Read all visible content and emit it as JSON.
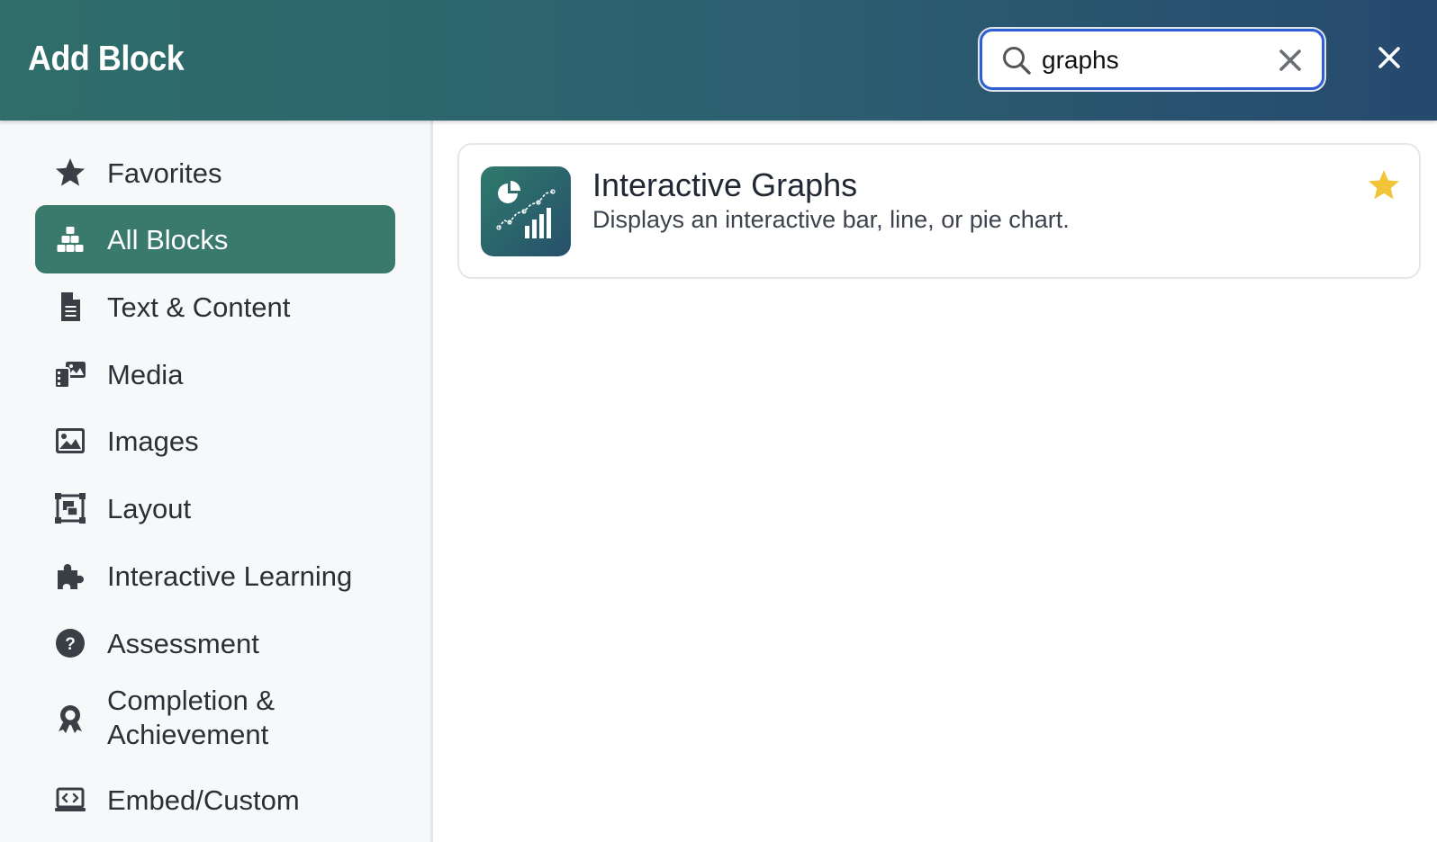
{
  "header": {
    "title": "Add Block",
    "search": {
      "value": "graphs",
      "placeholder": ""
    }
  },
  "colors": {
    "header_gradient": [
      "#2f6e6a",
      "#26496e"
    ],
    "active_nav": "#3a7a6c",
    "search_border": "#2d5fd2",
    "favorite_star": "#f2c438"
  },
  "sidebar": {
    "items": [
      {
        "label": "Favorites",
        "icon": "star-icon",
        "active": false
      },
      {
        "label": "All Blocks",
        "icon": "blocks-icon",
        "active": true
      },
      {
        "label": "Text & Content",
        "icon": "document-icon",
        "active": false
      },
      {
        "label": "Media",
        "icon": "media-icon",
        "active": false
      },
      {
        "label": "Images",
        "icon": "image-icon",
        "active": false
      },
      {
        "label": "Layout",
        "icon": "layout-icon",
        "active": false
      },
      {
        "label": "Interactive Learning",
        "icon": "puzzle-icon",
        "active": false
      },
      {
        "label": "Assessment",
        "icon": "question-circle-icon",
        "active": false
      },
      {
        "label": "Completion & Achievement",
        "icon": "award-icon",
        "active": false
      },
      {
        "label": "Embed/Custom",
        "icon": "embed-icon",
        "active": false
      }
    ]
  },
  "results": [
    {
      "title": "Interactive Graphs",
      "description": "Displays an interactive bar, line, or pie chart.",
      "icon": "chart-icon",
      "favorite": true
    }
  ]
}
